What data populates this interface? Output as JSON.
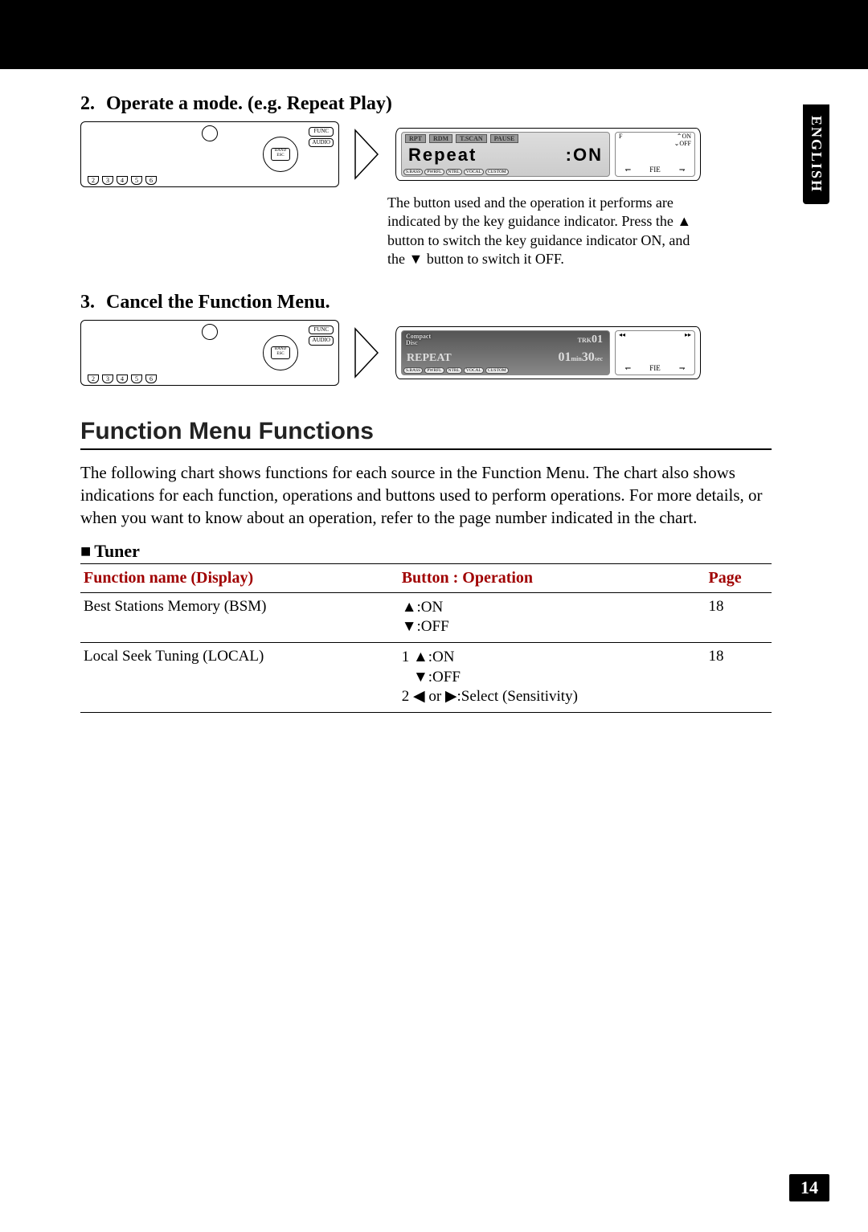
{
  "lang_tab": "ENGLISH",
  "page_number": "14",
  "steps": [
    {
      "number": "2.",
      "title": "Operate a mode. (e.g. Repeat Play)",
      "lcd_topbar": [
        "RPT",
        "RDM",
        "T.SCAN",
        "PAUSE"
      ],
      "lcd_big_left": "Repeat",
      "lcd_big_right": ":ON",
      "lcd_bottom": [
        "S.BASS",
        "PWRFL",
        "NTRL",
        "VOCAL",
        "CUSTOM"
      ],
      "side_top_left": "F",
      "side_top_on": "ON",
      "side_top_off": "OFF",
      "side_bottom": "FIE",
      "explain_1": "The button used and the operation it performs are indicated by the key guidance indicator. Press the ",
      "explain_tri_up": "▲",
      "explain_2": " button to switch the key guidance indicator ON, and the ",
      "explain_tri_down": "▼",
      "explain_3": " button to switch it OFF."
    },
    {
      "number": "3.",
      "title": "Cancel the Function Menu.",
      "cd_label_top": "Compact",
      "cd_label_bot": "Disc",
      "trk_label": "TRK",
      "trk_val": "01",
      "rep_label": "REPEAT",
      "time_min": "01",
      "time_min_u": "min",
      "time_sec": "30",
      "time_sec_u": "sec",
      "side_prev": "◂◂",
      "side_next": "▸▸",
      "side_bottom": "FIE",
      "lcd_bottom": [
        "S.BASS",
        "PWRFL",
        "NTRL",
        "VOCAL",
        "CUSTOM"
      ]
    }
  ],
  "device_labels": {
    "func": "FUNC",
    "band": "BAND ESC",
    "audio": "AUDIO",
    "btns": [
      "2",
      "3",
      "4",
      "5",
      "6"
    ]
  },
  "section_heading": "Function Menu Functions",
  "section_paragraph": "The following chart shows functions for each source in the Function Menu. The chart also shows indications for each function, operations and buttons used to perform operations. For more details, or when you want to know about an operation, refer to the page number indicated in the chart.",
  "subheading": "Tuner",
  "subheading_marker": "■",
  "table": {
    "headers": [
      "Function name (Display)",
      "Button : Operation",
      "Page"
    ],
    "rows": [
      {
        "name": "Best Stations Memory (BSM)",
        "ops": [
          "▲:ON",
          "▼:OFF"
        ],
        "page": "18"
      },
      {
        "name": "Local Seek Tuning (LOCAL)",
        "ops": [
          "1 ▲:ON",
          "   ▼:OFF",
          "2 ◀ or ▶:Select (Sensitivity)"
        ],
        "page": "18"
      }
    ]
  },
  "chart_data": {
    "type": "table",
    "title": "Tuner — Function Menu",
    "columns": [
      "Function name (Display)",
      "Button : Operation",
      "Page"
    ],
    "rows": [
      [
        "Best Stations Memory (BSM)",
        "▲:ON / ▼:OFF",
        18
      ],
      [
        "Local Seek Tuning (LOCAL)",
        "1 ▲:ON / ▼:OFF ; 2 ◀ or ▶:Select (Sensitivity)",
        18
      ]
    ]
  }
}
